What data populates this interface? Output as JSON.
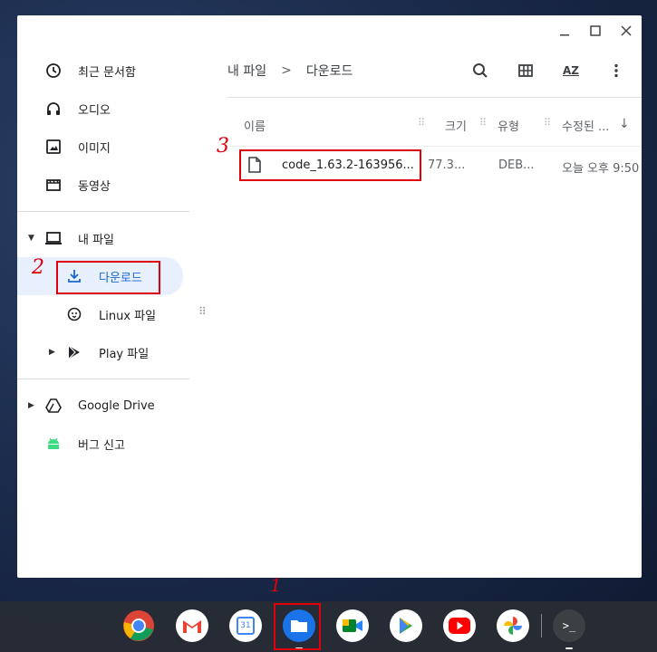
{
  "window": {
    "minimize_icon": "minimize-icon",
    "maximize_icon": "maximize-icon",
    "close_icon": "close-icon"
  },
  "sidebar": {
    "items": [
      {
        "label": "최근 문서함",
        "icon": "clock-icon"
      },
      {
        "label": "오디오",
        "icon": "headphones-icon"
      },
      {
        "label": "이미지",
        "icon": "image-icon"
      },
      {
        "label": "동영상",
        "icon": "film-icon"
      },
      {
        "label": "내 파일",
        "icon": "laptop-icon"
      },
      {
        "label": "다운로드",
        "icon": "download-icon"
      },
      {
        "label": "Linux 파일",
        "icon": "penguin-icon"
      },
      {
        "label": "Play 파일",
        "icon": "play-icon"
      },
      {
        "label": "Google Drive",
        "icon": "drive-icon"
      },
      {
        "label": "버그 신고",
        "icon": "android-icon"
      }
    ]
  },
  "breadcrumb": {
    "root": "내 파일",
    "separator": ">",
    "current": "다운로드"
  },
  "toolbar": {
    "sort_label": "AZ",
    "icons": [
      "search-icon",
      "grid-view-icon",
      "sort-icon",
      "more-vert-icon"
    ]
  },
  "table": {
    "headers": {
      "name": "이름",
      "size": "크기",
      "type": "유형",
      "modified": "수정된 ..."
    },
    "rows": [
      {
        "name": "code_1.63.2-163956...",
        "size": "77.3...",
        "type": "DEB...",
        "modified": "오늘 오후 9:50"
      }
    ]
  },
  "annotations": {
    "n1": "1",
    "n2": "2",
    "n3": "3",
    "color": "#e0000a"
  },
  "shelf": {
    "apps": [
      "chrome-icon",
      "gmail-icon",
      "calendar-icon",
      "files-icon",
      "meet-icon",
      "play-store-icon",
      "youtube-icon",
      "photos-icon",
      "terminal-icon"
    ],
    "calendar_day": "31"
  }
}
